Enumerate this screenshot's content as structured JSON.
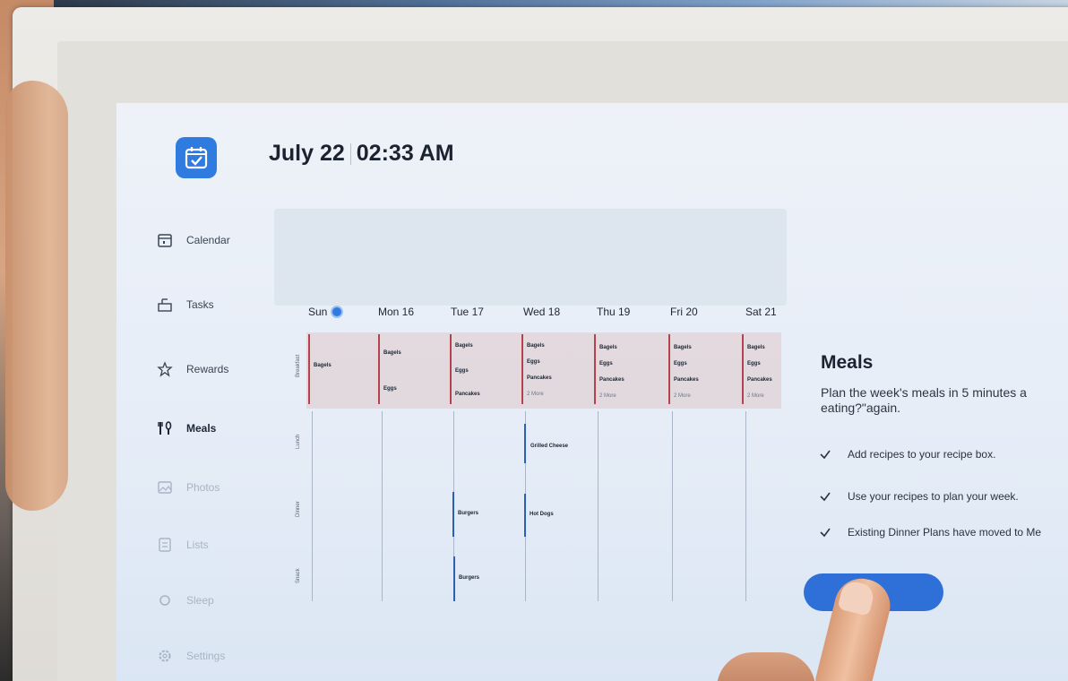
{
  "header": {
    "date": "July 22",
    "time": "02:33 AM"
  },
  "sidebar": {
    "items": [
      {
        "label": "Calendar",
        "icon": "calendar-icon"
      },
      {
        "label": "Tasks",
        "icon": "tasks-icon"
      },
      {
        "label": "Rewards",
        "icon": "rewards-icon"
      },
      {
        "label": "Meals",
        "icon": "meals-icon"
      },
      {
        "label": "Photos",
        "icon": "photos-icon"
      },
      {
        "label": "Lists",
        "icon": "lists-icon"
      },
      {
        "label": "Sleep",
        "icon": "sleep-icon"
      },
      {
        "label": "Settings",
        "icon": "settings-icon"
      }
    ]
  },
  "calendar": {
    "days": [
      "Sun",
      "Mon 16",
      "Tue 17",
      "Wed 18",
      "Thu 19",
      "Fri 20",
      "Sat 21"
    ],
    "rows": [
      "Breakfast",
      "Lunch",
      "Dinner",
      "Snack"
    ],
    "breakfast": [
      [
        "Bagels"
      ],
      [
        "Bagels",
        "Eggs"
      ],
      [
        "Bagels",
        "Eggs",
        "Pancakes"
      ],
      [
        "Bagels",
        "Eggs",
        "Pancakes",
        "2 More"
      ],
      [
        "Bagels",
        "Eggs",
        "Pancakes",
        "2 More"
      ],
      [
        "Bagels",
        "Eggs",
        "Pancakes",
        "2 More"
      ],
      [
        "Bagels",
        "Eggs",
        "Pancakes",
        "2 More"
      ]
    ],
    "lunch": {
      "wed": "Grilled Cheese"
    },
    "dinner": {
      "tue": "Burgers",
      "wed": "Hot Dogs"
    },
    "snack": {
      "tue": "Burgers"
    }
  },
  "panel": {
    "title": "Meals",
    "description": "Plan the week's meals in 5 minutes a eating?\"again.",
    "checks": [
      "Add recipes to your recipe box.",
      "Use your recipes to plan your week.",
      "Existing Dinner Plans have moved to Me"
    ]
  },
  "colors": {
    "accent": "#2f7be0",
    "breakfast_marker": "#b5424e",
    "meal_marker": "#2d5fb3"
  }
}
